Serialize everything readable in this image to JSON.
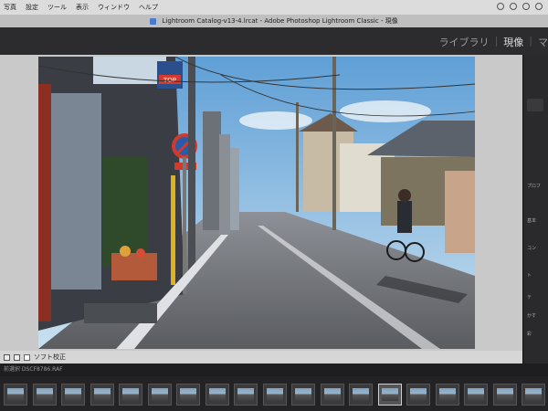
{
  "menubar": {
    "items": [
      "写真",
      "設定",
      "ツール",
      "表示",
      "ウィンドウ",
      "ヘルプ"
    ]
  },
  "window": {
    "title": "Lightroom Catalog-v13-4.lrcat - Adobe Photoshop Lightroom Classic - 現像"
  },
  "modules": {
    "library": "ライブラリ",
    "develop": "現像",
    "map": "マ"
  },
  "toolbar": {
    "soft_proof_label": "ソフト校正"
  },
  "filmstrip": {
    "info": "前選択 DSCF8786.RAF",
    "thumbnail_count": 19,
    "selected_index": 13
  },
  "right_panel": {
    "items": [
      "プロフ",
      "基本",
      "コン",
      "ト",
      "テ",
      "かす",
      "彩"
    ]
  },
  "photo": {
    "shop_sign": "TOP"
  },
  "colors": {
    "module_active": "#dedede",
    "module_inactive": "#9a9a9a",
    "workarea_bg": "#c9c9c9",
    "panel_bg": "#2a2a2c"
  }
}
